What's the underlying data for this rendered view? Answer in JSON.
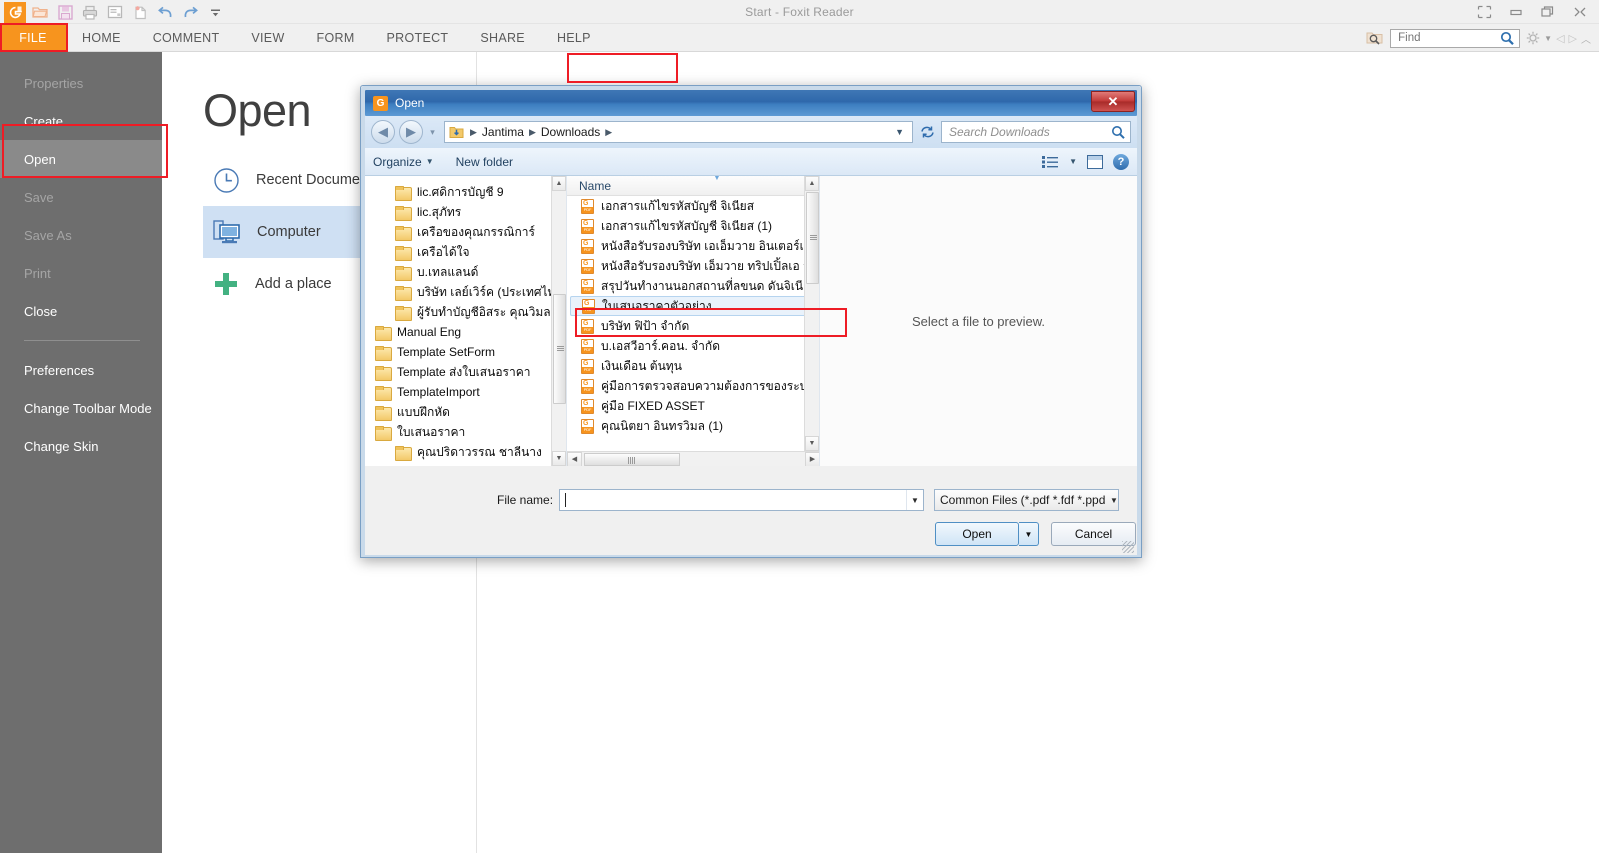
{
  "app": {
    "title": "Start - Foxit Reader",
    "quick_access": [
      {
        "name": "foxit-logo-icon",
        "label": "G"
      },
      {
        "name": "open-folder-icon",
        "label": ""
      },
      {
        "name": "save-icon",
        "label": ""
      },
      {
        "name": "print-icon",
        "label": ""
      },
      {
        "name": "properties-icon",
        "label": ""
      },
      {
        "name": "new-icon",
        "label": ""
      },
      {
        "name": "undo-icon",
        "label": ""
      },
      {
        "name": "redo-icon",
        "label": ""
      },
      {
        "name": "customize-icon",
        "label": ""
      }
    ],
    "window_controls": [
      "restore-layout",
      "minimize",
      "maximize",
      "close"
    ]
  },
  "ribbon": {
    "tabs": [
      {
        "label": "FILE",
        "active": true
      },
      {
        "label": "HOME",
        "active": false
      },
      {
        "label": "COMMENT",
        "active": false
      },
      {
        "label": "VIEW",
        "active": false
      },
      {
        "label": "FORM",
        "active": false
      },
      {
        "label": "PROTECT",
        "active": false
      },
      {
        "label": "SHARE",
        "active": false
      },
      {
        "label": "HELP",
        "active": false
      }
    ],
    "find": {
      "value": "",
      "placeholder": "Find"
    }
  },
  "backstage": {
    "heading": "Open",
    "menu": [
      {
        "label": "Properties",
        "state": "disabled"
      },
      {
        "label": "Create",
        "state": "normal"
      },
      {
        "label": "Open",
        "state": "selected"
      },
      {
        "label": "Save",
        "state": "disabled"
      },
      {
        "label": "Save As",
        "state": "disabled"
      },
      {
        "label": "Print",
        "state": "disabled"
      },
      {
        "label": "Close",
        "state": "normal"
      },
      {
        "label": "Preferences",
        "state": "normal"
      },
      {
        "label": "Change Toolbar Mode",
        "state": "normal"
      },
      {
        "label": "Change Skin",
        "state": "normal"
      }
    ],
    "places": [
      {
        "label": "Recent Documents",
        "icon": "clock-icon",
        "selected": false
      },
      {
        "label": "Computer",
        "icon": "computer-icon",
        "selected": true
      },
      {
        "label": "Add a place",
        "icon": "plus-icon",
        "selected": false
      }
    ]
  },
  "dialog": {
    "title": "Open",
    "breadcrumbs": [
      "Jantima",
      "Downloads"
    ],
    "search": {
      "placeholder": "Search Downloads",
      "value": ""
    },
    "toolbar": {
      "organize": "Organize",
      "new_folder": "New folder"
    },
    "tree": [
      {
        "label": "lic.ศดิการบัญชี 9",
        "level": 2
      },
      {
        "label": "lic.สุภัทร",
        "level": 2
      },
      {
        "label": "เครือของคุณกรรณิการ์",
        "level": 2
      },
      {
        "label": "เครือได้ใจ",
        "level": 2
      },
      {
        "label": "บ.เทลแลนด์",
        "level": 2
      },
      {
        "label": "บริษัท เลย์เวิร์ค (ประเทศไทย",
        "level": 2
      },
      {
        "label": "ผู้รับทำบัญชีอิสระ คุณวิมลศิริ",
        "level": 2
      },
      {
        "label": "Manual Eng",
        "level": 1
      },
      {
        "label": "Template SetForm",
        "level": 1
      },
      {
        "label": "Template ส่งใบเสนอราคา",
        "level": 1
      },
      {
        "label": "TemplateImport",
        "level": 1
      },
      {
        "label": "แบบฝึกหัด",
        "level": 1
      },
      {
        "label": "ใบเสนอราคา",
        "level": 1
      },
      {
        "label": "คุณปริดาวรรณ ชาลีนาง",
        "level": 2
      }
    ],
    "list_header": "Name",
    "files": [
      {
        "label": "เอกสารแก้ไขรหัสบัญชี จิเนียส",
        "selected": false
      },
      {
        "label": "เอกสารแก้ไขรหัสบัญชี จิเนียส (1)",
        "selected": false
      },
      {
        "label": "หนังสือรับรองบริษัท เอเอ็มวาย อินเตอร์เทรดดี..",
        "selected": false
      },
      {
        "label": "หนังสือรับรองบริษัท เอ็มวาย ทริปเปิ้ลเอ จำกัด",
        "selected": false
      },
      {
        "label": "สรุปวันทำงานนอกสถานที่ลขนด ดันจิเนียร",
        "selected": false
      },
      {
        "label": "ใบเสนอราคาตัวอย่าง",
        "selected": true
      },
      {
        "label": "บริษัท ฟิป้า จำกัด",
        "selected": false
      },
      {
        "label": "บ.เอสวีอาร์.คอน. จำกัด",
        "selected": false
      },
      {
        "label": "เงินเดือน ต้นทุน",
        "selected": false
      },
      {
        "label": "คู่มือการตรวจสอบความต้องการของระบบ",
        "selected": false
      },
      {
        "label": "คู่มือ FIXED ASSET",
        "selected": false
      },
      {
        "label": "คุณนิตยา อินทรวิมล (1)",
        "selected": false
      }
    ],
    "preview_message": "Select a file to preview.",
    "file_name_label": "File name:",
    "file_name_value": "",
    "file_type_value": "Common Files (*.pdf *.fdf *.ppd",
    "open_button": "Open",
    "cancel_button": "Cancel"
  },
  "colors": {
    "accent_orange": "#f7941e",
    "highlight_red": "#ee1c25",
    "selection_blue": "#cfe0f3",
    "backstage_gray": "#6e6e6e"
  }
}
